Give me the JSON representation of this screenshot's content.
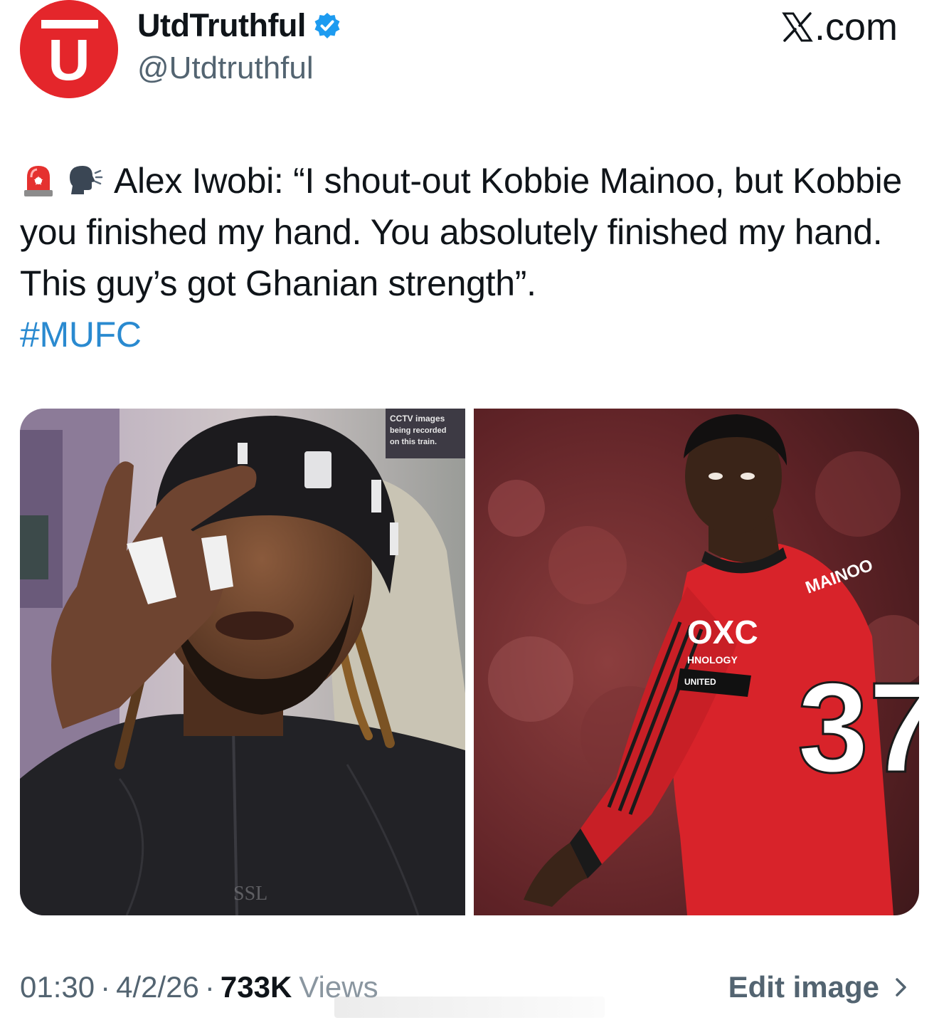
{
  "header": {
    "display_name": "UtdTruthful",
    "handle": "@Utdtruthful",
    "avatar_letter": "U",
    "avatar_color": "#e4262b",
    "verified_color": "#1d9bf0",
    "site_label": ".com",
    "site_icon": "x-logo-icon"
  },
  "tweet": {
    "emoji_1": "rotating-light-icon",
    "emoji_2": "speaking-head-icon",
    "text": "Alex Iwobi: “I shout-out Kobbie Mainoo, but Kobbie you finished my hand. You absolutely finished my hand. This guy’s got Ghanian strength”.",
    "hashtag": "#MUFC",
    "hashtag_color": "#2a8ad0"
  },
  "media": {
    "left_photo": {
      "sign_text_1": "CCTV images",
      "sign_text_2": "being recorded",
      "sign_text_3": "on this train."
    },
    "right_photo": {
      "shirt_sponsor": "OXC",
      "shirt_sponsor_sub": "HNOLOGY",
      "shirt_number": "37",
      "shirt_name": "MAINOO",
      "band_text": "UNITED",
      "shirt_color": "#d8232a"
    }
  },
  "footer": {
    "time": "01:30",
    "date": "4/2/26",
    "views_count": "733K",
    "views_label": "Views",
    "edit_label": "Edit image"
  }
}
